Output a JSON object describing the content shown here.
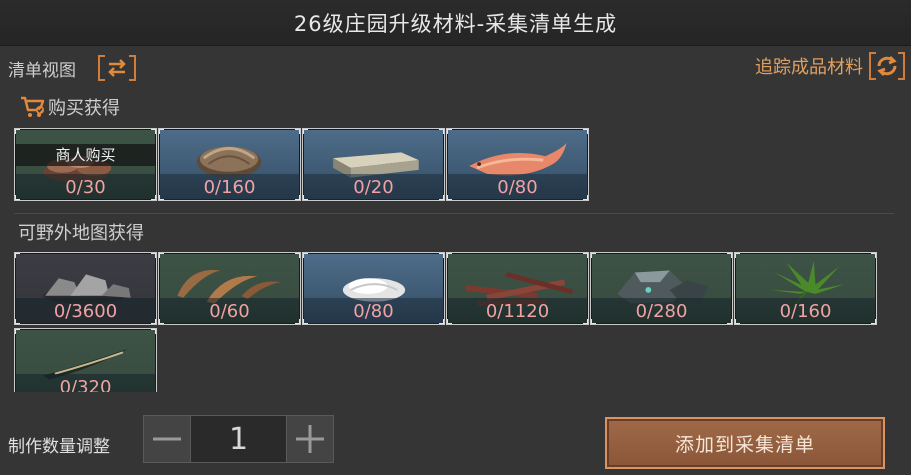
{
  "header": {
    "title": "26级庄园升级材料-采集清单生成"
  },
  "toolbar": {
    "list_view_label": "清单视图",
    "track_label": "追踪成品材料",
    "swap_icon": "swap-arrows-icon",
    "refresh_icon": "refresh-icon"
  },
  "sections": {
    "buy": {
      "title": "购买获得",
      "icon": "shopping-cart-icon"
    },
    "wild": {
      "title": "可野外地图获得"
    }
  },
  "buy_items": [
    {
      "name": "wood-bark",
      "count": "0/30",
      "tag": "商人购买",
      "rarity": "green"
    },
    {
      "name": "shell",
      "count": "0/160",
      "rarity": "blue"
    },
    {
      "name": "metal-ingot",
      "count": "0/20",
      "rarity": "blue"
    },
    {
      "name": "red-fish",
      "count": "0/80",
      "rarity": "blue"
    }
  ],
  "wild_items": [
    {
      "name": "rock-pile",
      "count": "0/3600",
      "rarity": "gray"
    },
    {
      "name": "claws",
      "count": "0/60",
      "rarity": "green"
    },
    {
      "name": "white-fluff",
      "count": "0/80",
      "rarity": "blue"
    },
    {
      "name": "branches",
      "count": "0/1120",
      "rarity": "green"
    },
    {
      "name": "ore-stone",
      "count": "0/280",
      "rarity": "green"
    },
    {
      "name": "herb-leaf",
      "count": "0/160",
      "rarity": "green"
    },
    {
      "name": "horn",
      "count": "0/320",
      "rarity": "green"
    }
  ],
  "footer": {
    "quantity_label": "制作数量调整",
    "quantity_value": "1",
    "add_button_label": "添加到采集清单"
  },
  "colors": {
    "accent_orange": "#d07d3b",
    "count_pink": "#f1a2a2",
    "tile_green": "#3a4e42",
    "tile_blue": "#3f5a73"
  }
}
